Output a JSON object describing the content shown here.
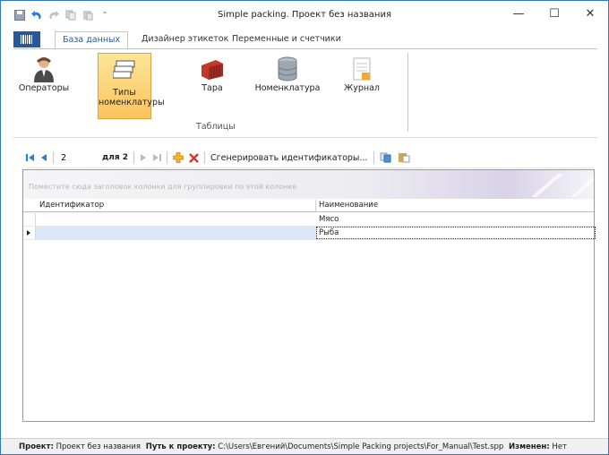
{
  "window": {
    "title": "Simple packing. Проект без названия",
    "controls": {
      "minimize": "—",
      "maximize": "☐",
      "close": "✕"
    }
  },
  "ribbon": {
    "tabs": [
      {
        "label": "База данных",
        "active": true
      },
      {
        "label": "Дизайнер этикеток",
        "active": false
      },
      {
        "label": "Переменные и счетчики",
        "active": false
      }
    ],
    "buttons": [
      {
        "label": "Операторы",
        "icon": "operator-icon"
      },
      {
        "label": "Типы номенклатуры",
        "icon": "nomenclature-types-icon",
        "selected": true
      },
      {
        "label": "Тара",
        "icon": "container-icon"
      },
      {
        "label": "Номенклатура",
        "icon": "database-icon"
      },
      {
        "label": "Журнал",
        "icon": "journal-icon"
      }
    ],
    "group_label": "Таблицы"
  },
  "navigator": {
    "page_value": "2",
    "of_label": "для 2",
    "generate_label": "Сгенерировать идентификаторы..."
  },
  "grid": {
    "group_panel_hint": "Поместите сюда заголовок колонки для группировки по этой колонке",
    "columns": [
      "Идентификатор",
      "Наименование"
    ],
    "rows": [
      {
        "id": "",
        "name": "Мясо"
      },
      {
        "id": "",
        "name": "Рыба"
      }
    ]
  },
  "status": {
    "project_label": "Проект:",
    "project_value": "Проект без названия",
    "path_label": "Путь к проекту:",
    "path_value": "C:\\Users\\Евгений\\Documents\\Simple Packing projects\\For_Manual\\Test.spp",
    "changed_label": "Изменен:",
    "changed_value": "Нет"
  },
  "colors": {
    "accent": "#2b579a",
    "selected_button": "#fbc45c",
    "selected_row": "#dde8f7"
  }
}
